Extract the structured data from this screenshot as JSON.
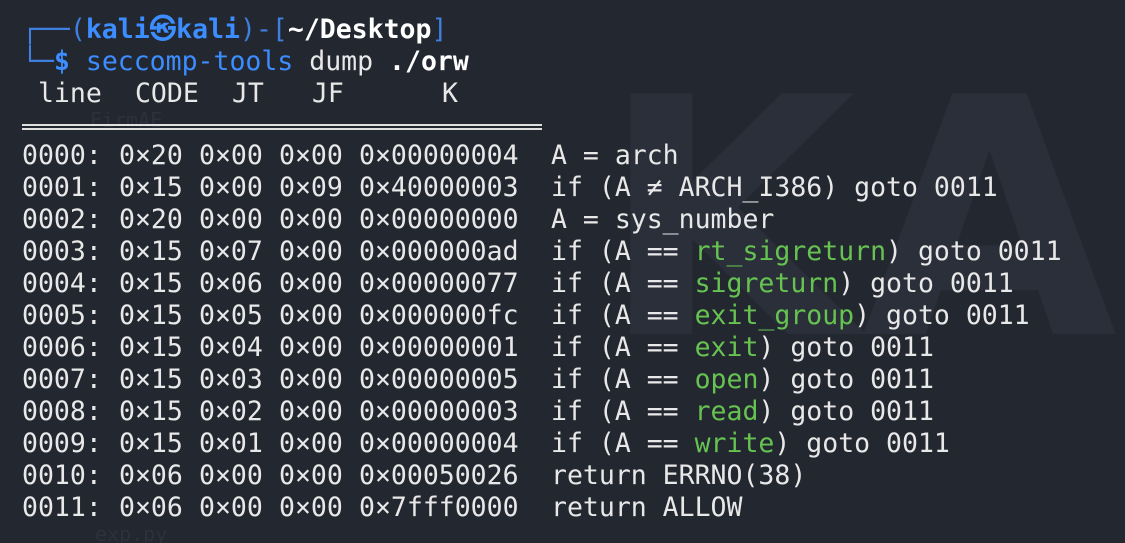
{
  "prompt": {
    "box_top_left": "┌──(",
    "user": "kali",
    "at_symbol": "㉿",
    "host": "kali",
    "mid": ")-[",
    "dir": "~/Desktop",
    "close": "]",
    "box_bottom_left": "└─",
    "dollar": "$",
    "command": "seccomp-tools",
    "args": "dump",
    "path": "./orw"
  },
  "header": {
    "line": "line",
    "code": "CODE",
    "jt": "JT",
    "jf": "JF",
    "k": "K"
  },
  "watermark": "KALI",
  "ghost": {
    "firmae": "FirmAE",
    "exp": "exp.py"
  },
  "rows": [
    {
      "line": "0000:",
      "code": "0×20",
      "jt": "0×00",
      "jf": "0×00",
      "k": "0×00000004",
      "pre": "A = arch",
      "sys": "",
      "post": ""
    },
    {
      "line": "0001:",
      "code": "0×15",
      "jt": "0×00",
      "jf": "0×09",
      "k": "0×40000003",
      "pre": "if (A ≠ ARCH_I386) goto 0011",
      "sys": "",
      "post": ""
    },
    {
      "line": "0002:",
      "code": "0×20",
      "jt": "0×00",
      "jf": "0×00",
      "k": "0×00000000",
      "pre": "A = sys_number",
      "sys": "",
      "post": ""
    },
    {
      "line": "0003:",
      "code": "0×15",
      "jt": "0×07",
      "jf": "0×00",
      "k": "0×000000ad",
      "pre": "if (A == ",
      "sys": "rt_sigreturn",
      "post": ") goto 0011"
    },
    {
      "line": "0004:",
      "code": "0×15",
      "jt": "0×06",
      "jf": "0×00",
      "k": "0×00000077",
      "pre": "if (A == ",
      "sys": "sigreturn",
      "post": ") goto 0011"
    },
    {
      "line": "0005:",
      "code": "0×15",
      "jt": "0×05",
      "jf": "0×00",
      "k": "0×000000fc",
      "pre": "if (A == ",
      "sys": "exit_group",
      "post": ") goto 0011"
    },
    {
      "line": "0006:",
      "code": "0×15",
      "jt": "0×04",
      "jf": "0×00",
      "k": "0×00000001",
      "pre": "if (A == ",
      "sys": "exit",
      "post": ") goto 0011"
    },
    {
      "line": "0007:",
      "code": "0×15",
      "jt": "0×03",
      "jf": "0×00",
      "k": "0×00000005",
      "pre": "if (A == ",
      "sys": "open",
      "post": ") goto 0011"
    },
    {
      "line": "0008:",
      "code": "0×15",
      "jt": "0×02",
      "jf": "0×00",
      "k": "0×00000003",
      "pre": "if (A == ",
      "sys": "read",
      "post": ") goto 0011"
    },
    {
      "line": "0009:",
      "code": "0×15",
      "jt": "0×01",
      "jf": "0×00",
      "k": "0×00000004",
      "pre": "if (A == ",
      "sys": "write",
      "post": ") goto 0011"
    },
    {
      "line": "0010:",
      "code": "0×06",
      "jt": "0×00",
      "jf": "0×00",
      "k": "0×00050026",
      "pre": "return ERRNO(38)",
      "sys": "",
      "post": ""
    },
    {
      "line": "0011:",
      "code": "0×06",
      "jt": "0×00",
      "jf": "0×00",
      "k": "0×7fff0000",
      "pre": "return ALLOW",
      "sys": "",
      "post": ""
    }
  ],
  "colors": {
    "background": "#232730",
    "prompt_blue": "#3c8dff",
    "syscall_green": "#67c351",
    "text": "#e8e8e8"
  }
}
